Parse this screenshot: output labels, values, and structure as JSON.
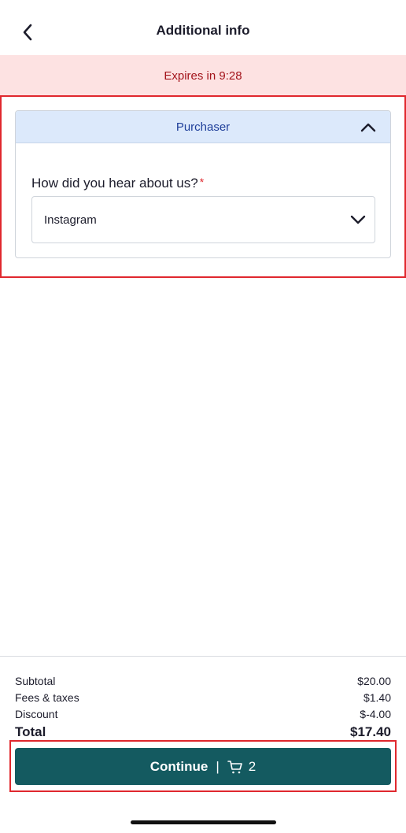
{
  "header": {
    "title": "Additional info",
    "back_icon": "chevron-left-icon"
  },
  "banner": {
    "expires_text": "Expires in 9:28",
    "background": "#fde2e2",
    "text_color": "#a3141b"
  },
  "card": {
    "section_title": "Purchaser",
    "collapse_icon": "chevron-up-icon",
    "question_label": "How did you hear about us?",
    "required_mark": "*",
    "select_value": "Instagram",
    "select_icon": "chevron-down-icon"
  },
  "summary": {
    "subtotal_label": "Subtotal",
    "subtotal_value": "$20.00",
    "fees_label": "Fees & taxes",
    "fees_value": "$1.40",
    "discount_label": "Discount",
    "discount_value": "$-4.00",
    "total_label": "Total",
    "total_value": "$17.40"
  },
  "continue_button": {
    "label": "Continue",
    "separator": "|",
    "cart_icon": "cart-icon",
    "cart_count": "2",
    "background": "#145a60"
  },
  "colors": {
    "accent": "#145a60",
    "highlight": "#e0282e",
    "card_header": "#dce9fb"
  }
}
